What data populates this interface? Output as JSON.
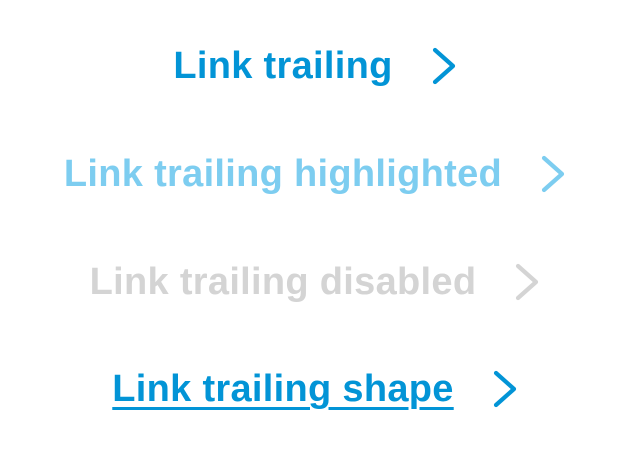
{
  "links": [
    {
      "label": "Link trailing",
      "icon": "chevron-right-icon",
      "state": "default",
      "color": "#0294d6"
    },
    {
      "label": "Link trailing highlighted",
      "icon": "chevron-right-icon",
      "state": "highlighted",
      "color": "#7dcdf0"
    },
    {
      "label": "Link trailing disabled",
      "icon": "chevron-right-icon",
      "state": "disabled",
      "color": "#d4d4d4"
    },
    {
      "label": "Link trailing shape",
      "icon": "chevron-right-icon",
      "state": "underlined",
      "color": "#0294d6"
    }
  ]
}
